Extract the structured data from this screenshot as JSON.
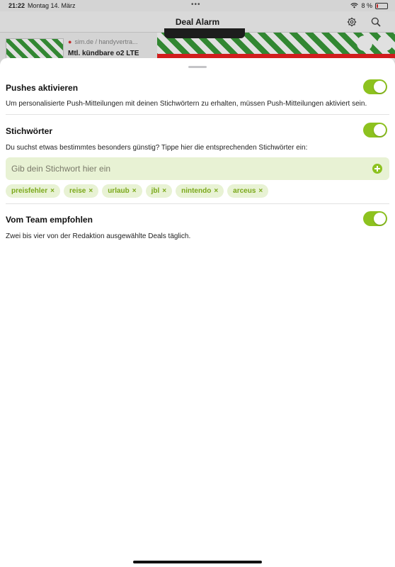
{
  "status_bar": {
    "time": "21:22",
    "date": "Montag 14. März",
    "dots": "•••",
    "battery": "8 %"
  },
  "nav": {
    "title": "Deal Alarm",
    "gear_icon": "gear-icon",
    "search_icon": "search-icon"
  },
  "background_deal": {
    "source": "sim.de / handyvertra...",
    "title": "Mtl. kündbare o2 LTE"
  },
  "sheet": {
    "push": {
      "title": "Pushes aktivieren",
      "description": "Um personalisierte Push-Mitteilungen mit deinen Stichwörtern zu erhalten, müssen Push-Mitteilungen aktiviert sein.",
      "enabled": true
    },
    "keywords": {
      "title": "Stichwörter",
      "description": "Du suchst etwas bestimmtes besonders günstig? Tippe hier die entsprechenden Stichwörter ein:",
      "enabled": true,
      "input_placeholder": "Gib dein Stichwort hier ein",
      "remove_symbol": "×",
      "items": [
        "preisfehler",
        "reise",
        "urlaub",
        "jbl",
        "nintendo",
        "arceus"
      ]
    },
    "team": {
      "title": "Vom Team empfohlen",
      "description": "Zwei bis vier von der Redaktion ausgewählte Deals täglich.",
      "enabled": true
    }
  },
  "colors": {
    "accent": "#8dc21f",
    "chip_bg": "#e8f2d4",
    "chip_text": "#7aa81a"
  }
}
